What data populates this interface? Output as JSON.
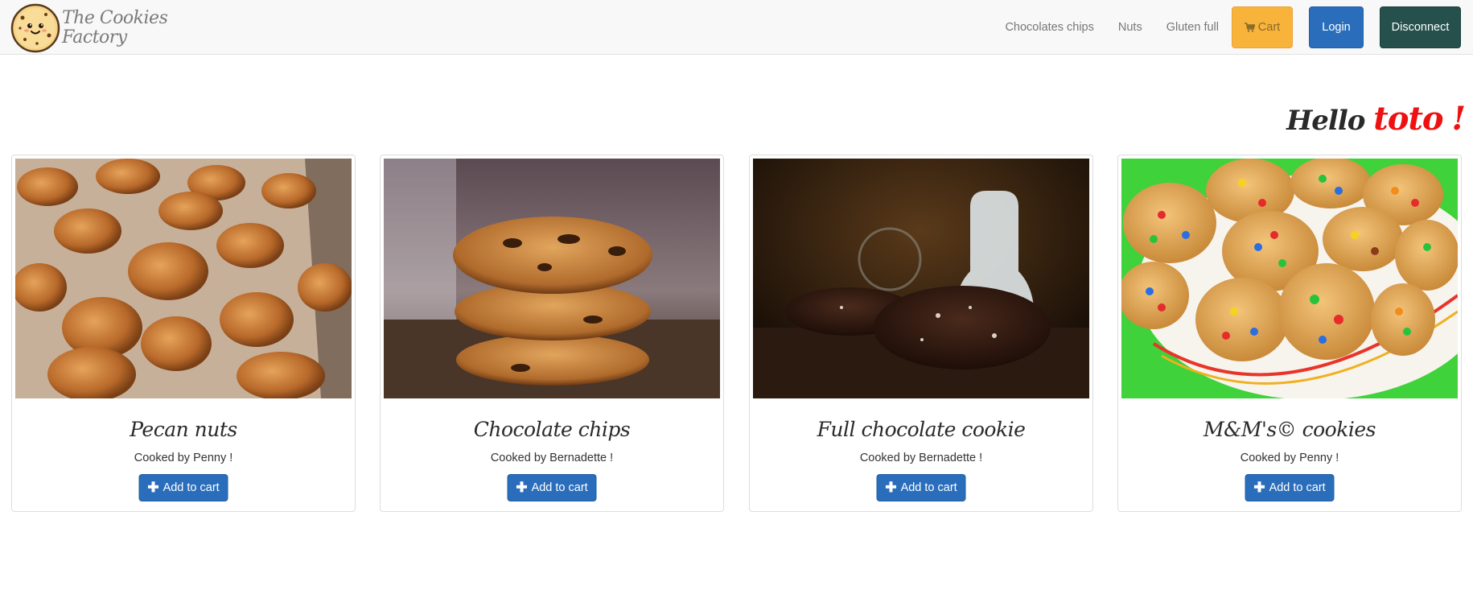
{
  "brand": {
    "line1": "The Cookies",
    "line2": "Factory",
    "logo_icon": "cookie-face-icon"
  },
  "nav": {
    "links": [
      "Chocolates chips",
      "Nuts",
      "Gluten full"
    ],
    "cart_label": "Cart",
    "cart_icon": "shopping-cart-icon",
    "login_label": "Login",
    "disconnect_label": "Disconnect"
  },
  "greeting": {
    "hello": "Hello",
    "name": "toto",
    "exclaim": "!"
  },
  "products": [
    {
      "title": "Pecan nuts",
      "cook": "Cooked by Penny !",
      "button": "Add to cart",
      "image": "pecan-cookies-photo"
    },
    {
      "title": "Chocolate chips",
      "cook": "Cooked by Bernadette !",
      "button": "Add to cart",
      "image": "chocolate-chip-cookies-photo"
    },
    {
      "title": "Full chocolate cookie",
      "cook": "Cooked by Bernadette !",
      "button": "Add to cart",
      "image": "full-chocolate-cookie-photo"
    },
    {
      "title": "M&M's© cookies",
      "cook": "Cooked by Penny !",
      "button": "Add to cart",
      "image": "mm-cookies-photo"
    }
  ],
  "colors": {
    "primary": "#2a6ebb",
    "warning": "#f8b33a",
    "dark_teal": "#25504c",
    "accent_red": "#ee1111"
  }
}
